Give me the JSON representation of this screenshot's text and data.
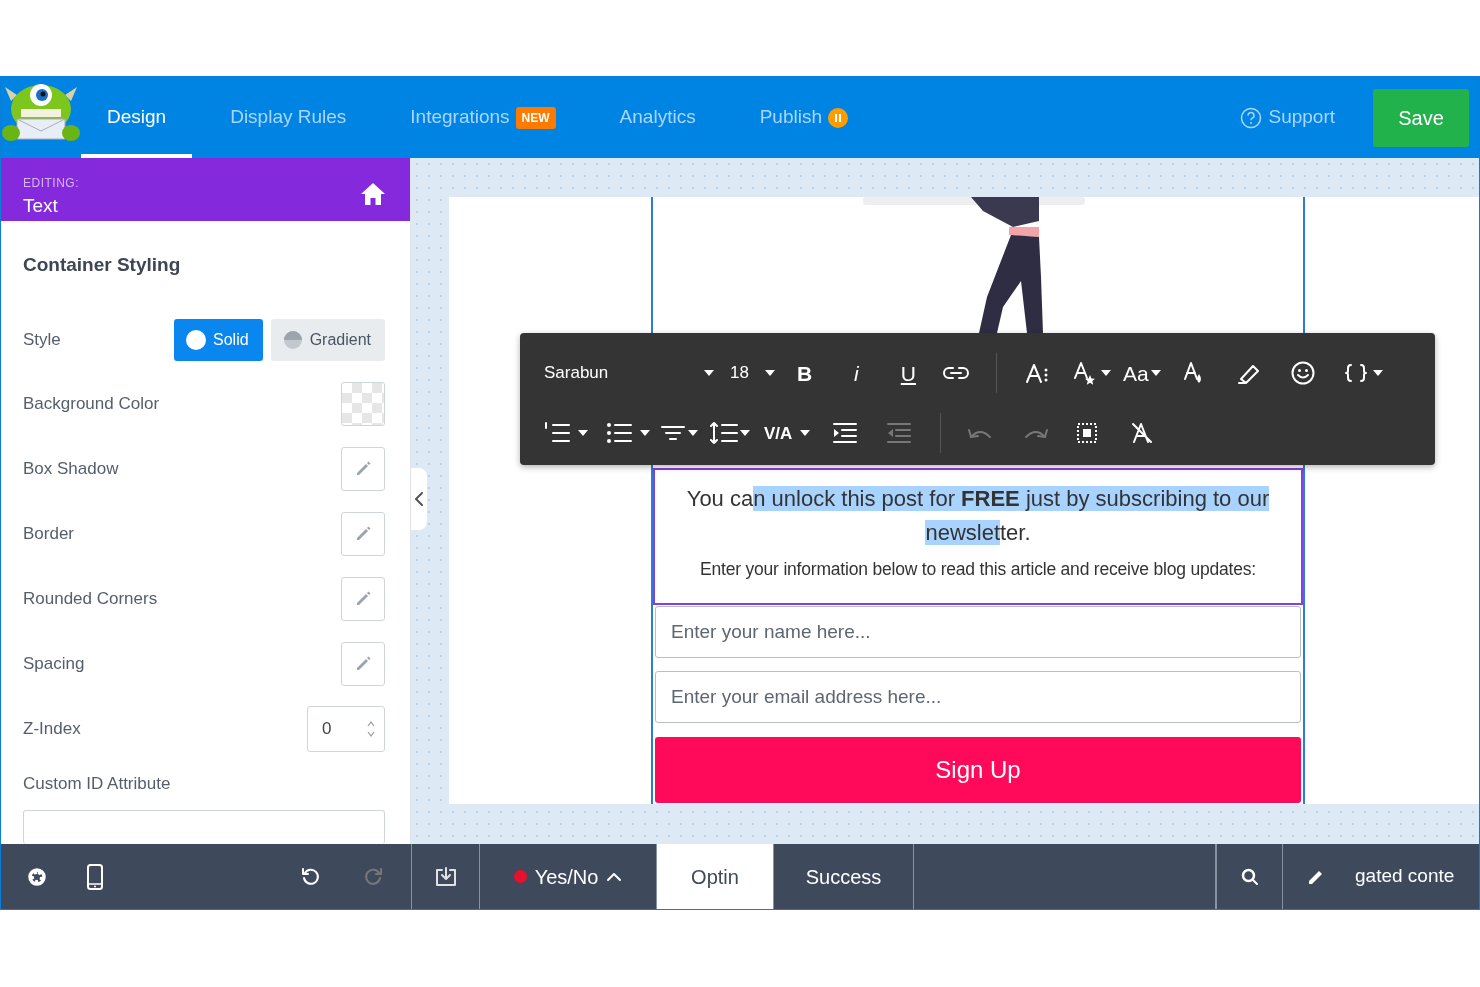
{
  "header": {
    "tabs": [
      {
        "label": "Design",
        "selected": true
      },
      {
        "label": "Display Rules",
        "selected": false
      },
      {
        "label": "Integrations",
        "selected": false,
        "badge": "NEW"
      },
      {
        "label": "Analytics",
        "selected": false
      },
      {
        "label": "Publish",
        "selected": false,
        "paused": true
      }
    ],
    "support": "Support",
    "save": "Save"
  },
  "editing": {
    "caption": "EDITING:",
    "element": "Text"
  },
  "panel": {
    "title": "Container Styling",
    "rows": [
      {
        "kind": "toggle",
        "label": "Style",
        "options": [
          {
            "label": "Solid",
            "selected": true
          },
          {
            "label": "Gradient",
            "selected": false
          }
        ]
      },
      {
        "kind": "color",
        "label": "Background Color"
      },
      {
        "kind": "edit",
        "label": "Box Shadow"
      },
      {
        "kind": "edit",
        "label": "Border"
      },
      {
        "kind": "edit",
        "label": "Rounded Corners"
      },
      {
        "kind": "edit",
        "label": "Spacing"
      },
      {
        "kind": "number",
        "label": "Z-Index",
        "value": "0"
      },
      {
        "kind": "text",
        "label": "Custom ID Attribute"
      }
    ]
  },
  "toolbar": {
    "font": "Sarabun",
    "size": "18",
    "bold": "B",
    "italic": "i",
    "underline": "U",
    "text_case": "Aa",
    "spacing": "V/A",
    "outdent": {
      "disabled": true
    },
    "undo": {
      "disabled": true
    },
    "redo": {
      "disabled": true
    }
  },
  "optin": {
    "headline": {
      "before": "You ca",
      "selected": "n unlock this post for **FREE** just by subscribing to our newslet",
      "after": "ter."
    },
    "subtext": "Enter your information below to read this article and receive blog updates:",
    "fields": [
      {
        "placeholder": "Enter your name here..."
      },
      {
        "placeholder": "Enter your email address here..."
      }
    ],
    "button": "Sign Up"
  },
  "bottom_bar": {
    "redo": {
      "disabled": true
    },
    "yes_no": "Yes/No",
    "tabs": [
      {
        "label": "Optin",
        "selected": true
      },
      {
        "label": "Success",
        "selected": false
      }
    ],
    "campaign": "gated conte"
  }
}
